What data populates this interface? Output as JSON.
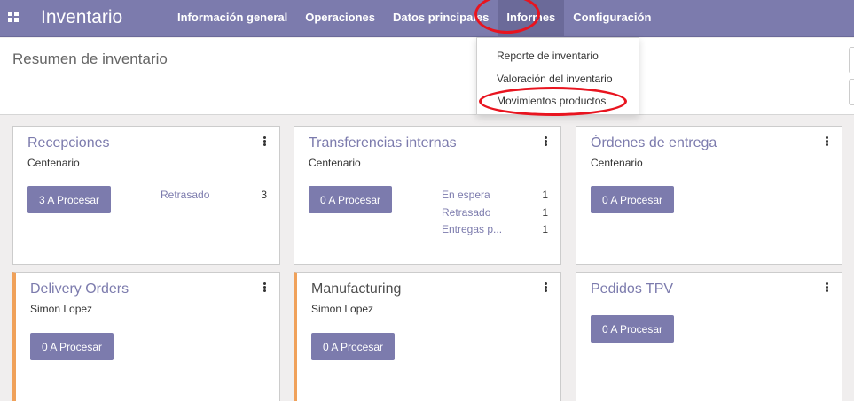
{
  "app": {
    "title": "Inventario"
  },
  "menu": {
    "items": [
      "Información general",
      "Operaciones",
      "Datos principales",
      "Informes",
      "Configuración"
    ],
    "active": "Informes"
  },
  "page": {
    "title": "Resumen de inventario"
  },
  "informes_dropdown": {
    "items": [
      "Reporte de inventario",
      "Valoración del inventario",
      "Movimientos productos"
    ]
  },
  "cards": [
    {
      "title": "Recepciones",
      "warehouse": "Centenario",
      "button": "3 A Procesar",
      "stats": [
        {
          "label": "Retrasado",
          "count": "3"
        }
      ]
    },
    {
      "title": "Transferencias internas",
      "warehouse": "Centenario",
      "button": "0 A Procesar",
      "stats": [
        {
          "label": "En espera",
          "count": "1"
        },
        {
          "label": "Retrasado",
          "count": "1"
        },
        {
          "label": "Entregas p...",
          "count": "1"
        }
      ]
    },
    {
      "title": "Órdenes de entrega",
      "warehouse": "Centenario",
      "button": "0 A Procesar",
      "stats": []
    },
    {
      "title": "Delivery Orders",
      "warehouse": "Simon Lopez",
      "button": "0 A Procesar",
      "stats": []
    },
    {
      "title": "Manufacturing",
      "warehouse": "Simon Lopez",
      "button": "0 A Procesar",
      "stats": []
    },
    {
      "title": "Pedidos TPV",
      "warehouse": "",
      "button": "0 A Procesar",
      "stats": []
    }
  ],
  "colors": {
    "navbar": "#7c7bad",
    "accent": "#f0a15a",
    "highlight": "#e8141f"
  },
  "icons": {
    "apps": "grid-icon",
    "card_menu": "kebab-icon"
  }
}
